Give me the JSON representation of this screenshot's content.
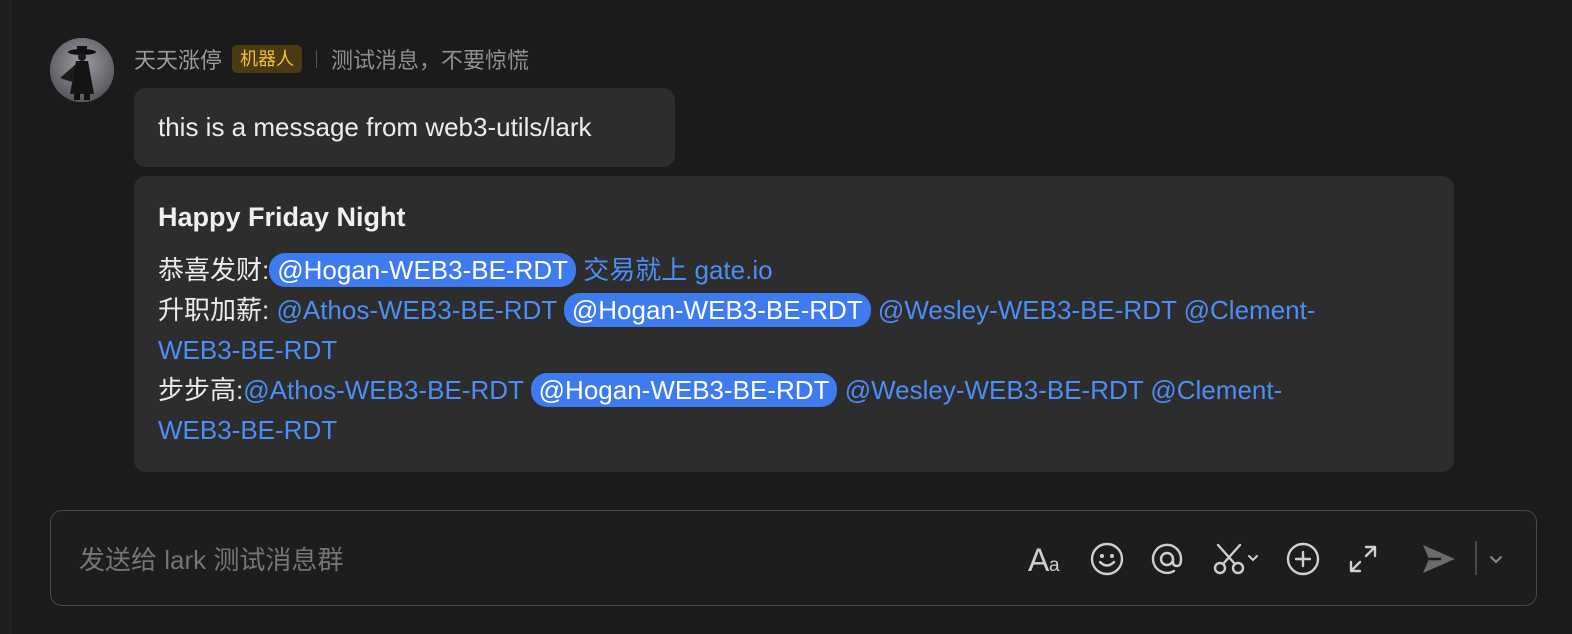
{
  "message": {
    "sender": "天天涨停",
    "bot_tag": "机器人",
    "subtitle": "测试消息，不要惊慌",
    "text": "this is a message from web3-utils/lark"
  },
  "card": {
    "title": "Happy Friday Night",
    "line1": {
      "label": "恭喜发财:",
      "mention_me": "@Hogan-WEB3-BE-RDT",
      "link": "交易就上 gate.io"
    },
    "line2": {
      "label": "升职加薪:",
      "mention1": "@Athos-WEB3-BE-RDT",
      "mention_me": "@Hogan-WEB3-BE-RDT",
      "mention3": "@Wesley-WEB3-BE-RDT",
      "mention4a": "@Clement-",
      "mention4b": "WEB3-BE-RDT"
    },
    "line3": {
      "label": "步步高:",
      "mention1": "@Athos-WEB3-BE-RDT",
      "mention_me": "@Hogan-WEB3-BE-RDT",
      "mention3": "@Wesley-WEB3-BE-RDT",
      "mention4a": "@Clement-",
      "mention4b": "WEB3-BE-RDT"
    }
  },
  "composer": {
    "placeholder": "发送给 lark 测试消息群",
    "tools": [
      "text-format-icon",
      "emoji-icon",
      "mention-icon",
      "scissors-icon",
      "add-icon",
      "expand-icon",
      "send-icon",
      "chevron-down-icon"
    ]
  },
  "colors": {
    "background": "#1b1b1b",
    "bubble": "#2d2d2d",
    "mention": "#4c8ef7",
    "mention_me_bg": "#3f7bf0",
    "bot_tag_bg": "#4a3b12",
    "bot_tag_text": "#f3c03d"
  }
}
